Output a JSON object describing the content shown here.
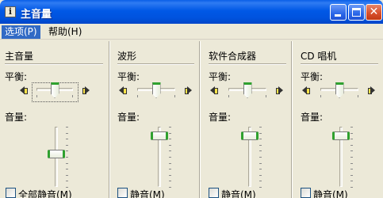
{
  "window": {
    "title": "主音量",
    "icon": "volume-app-icon",
    "controls": [
      "minimize-icon",
      "maximize-icon",
      "close-icon"
    ]
  },
  "menu": {
    "options": "选项(P)",
    "help": "帮助(H)"
  },
  "channels": {
    "master": {
      "name": "主音量",
      "balance_label": "平衡:",
      "volume_label": "音量:",
      "mute_label": "全部静音(M)",
      "balance": 0.5,
      "volume": 0.55,
      "muted": false
    },
    "wave": {
      "name": "波形",
      "balance_label": "平衡:",
      "volume_label": "音量:",
      "mute_label": "静音(M)",
      "balance": 0.5,
      "volume": 0.85,
      "muted": false
    },
    "synth": {
      "name": "软件合成器",
      "balance_label": "平衡:",
      "volume_label": "音量:",
      "mute_label": "静音(M)",
      "balance": 0.5,
      "volume": 0.85,
      "muted": false
    },
    "cd": {
      "name": "CD 唱机",
      "balance_label": "平衡:",
      "volume_label": "音量:",
      "mute_label": "静音(M)",
      "balance": 0.5,
      "volume": 0.85,
      "muted": false
    }
  },
  "colors": {
    "titlebar": "#0058E6",
    "face": "#ECE9D8",
    "thumb_accent": "#2FA12F",
    "menu_highlight": "#316AC5"
  }
}
